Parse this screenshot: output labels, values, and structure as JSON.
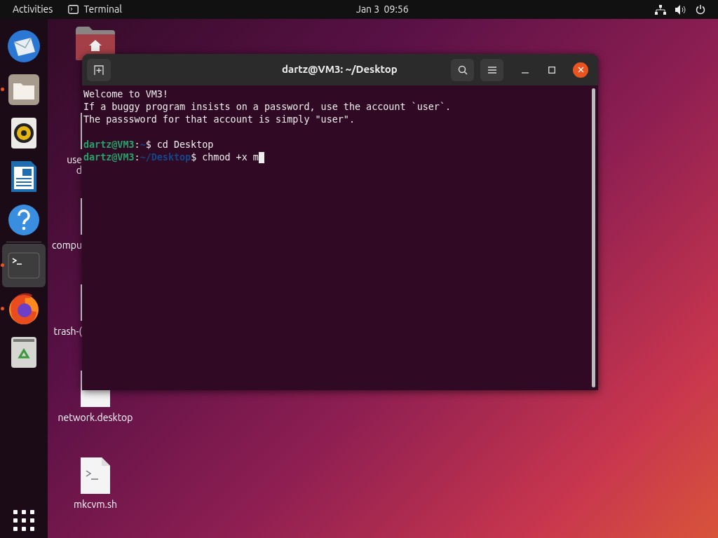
{
  "top_bar": {
    "activities": "Activities",
    "app_name": "Terminal",
    "clock": "Jan 3  09:56"
  },
  "dock": {
    "items": [
      {
        "kind": "mail",
        "running": false,
        "selected": false
      },
      {
        "kind": "files",
        "running": true,
        "selected": false
      },
      {
        "kind": "music",
        "running": false,
        "selected": false
      },
      {
        "kind": "writer",
        "running": false,
        "selected": false
      },
      {
        "kind": "help",
        "running": false,
        "selected": false
      },
      {
        "kind": "terminal",
        "running": true,
        "selected": true
      },
      {
        "kind": "browser",
        "running": true,
        "selected": false
      },
      {
        "kind": "trash",
        "running": false,
        "selected": false
      }
    ]
  },
  "desktop_icons": [
    {
      "kind": "home",
      "covered": false
    },
    {
      "kind": "file",
      "covered": true,
      "label_lines": [
        "use",
        "d"
      ]
    },
    {
      "kind": "file",
      "covered": true,
      "label_lines": [
        "compu"
      ]
    },
    {
      "kind": "file",
      "covered": true,
      "label_lines": [
        "trash-("
      ]
    },
    {
      "kind": "settings-file",
      "covered": false,
      "label_lines": [
        "network.desktop"
      ]
    },
    {
      "kind": "script",
      "covered": false,
      "label_lines": [
        "mkcvm.sh"
      ]
    }
  ],
  "terminal": {
    "title": "dartz@VM3: ~/Desktop",
    "lines": [
      {
        "kind": "text",
        "text": "Welcome to VM3!"
      },
      {
        "kind": "text",
        "text": "If a buggy program insists on a password, use the account `user`."
      },
      {
        "kind": "text",
        "text": "The passsword for that account is simply \"user\"."
      },
      {
        "kind": "blank"
      },
      {
        "kind": "prompt",
        "user": "dartz@VM3",
        "separator": ":",
        "path": "~",
        "symbol": "$",
        "command": "cd Desktop",
        "cursor": false
      },
      {
        "kind": "prompt",
        "user": "dartz@VM3",
        "separator": ":",
        "path": "~/Desktop",
        "symbol": "$",
        "command": "chmod +x m",
        "cursor": true
      }
    ]
  }
}
